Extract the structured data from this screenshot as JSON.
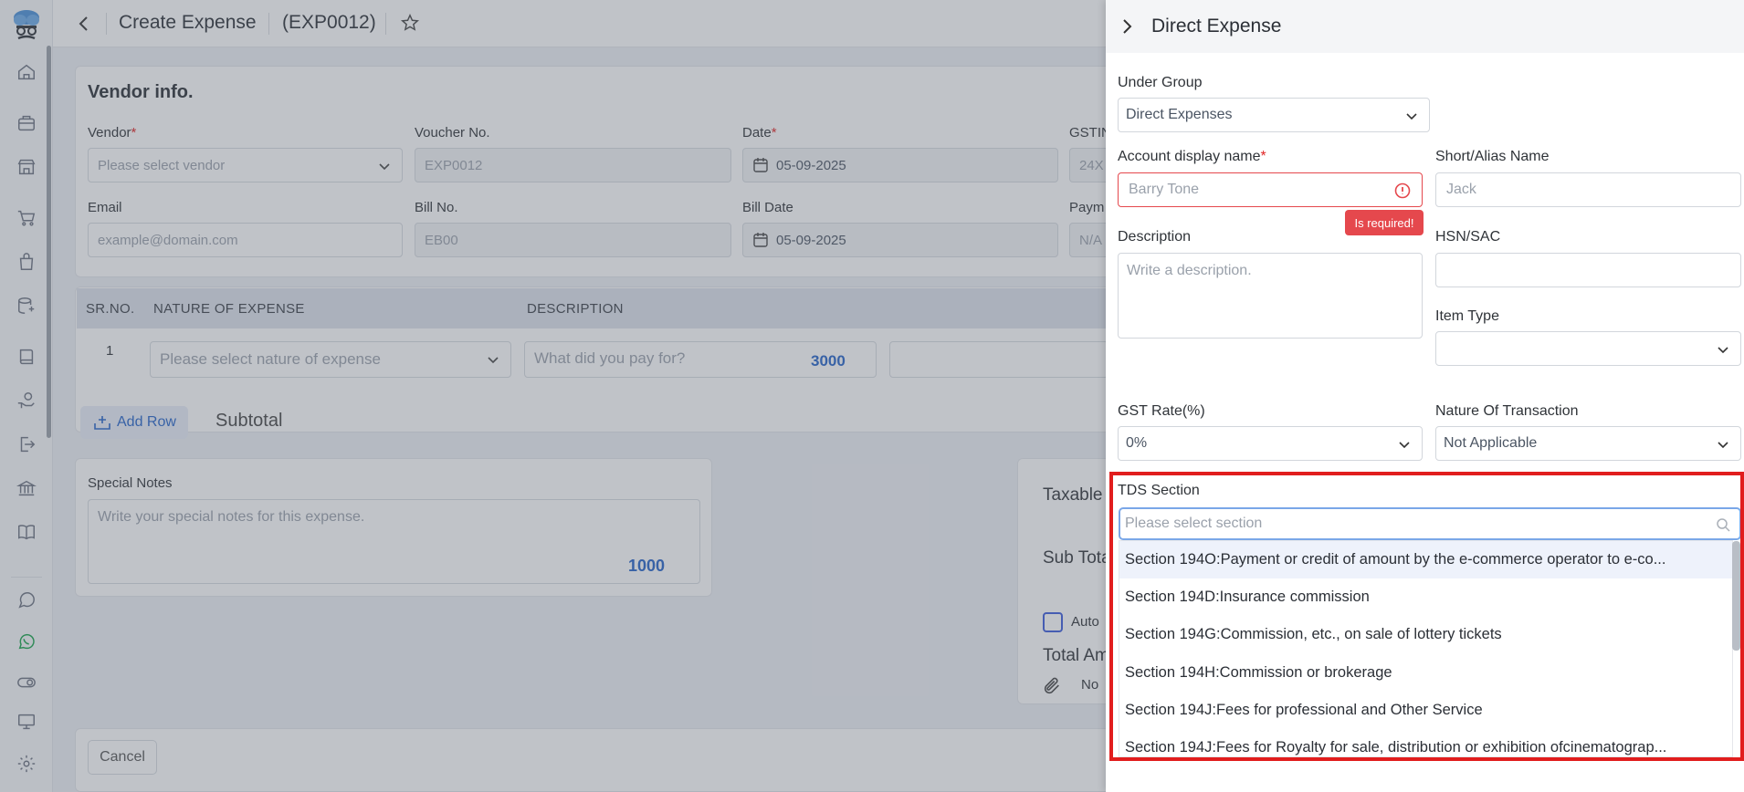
{
  "page": {
    "title": "Create Expense",
    "code": "(EXP0012)"
  },
  "vendor_info": {
    "heading": "Vendor info.",
    "vendor_label": "Vendor",
    "vendor_placeholder": "Please select vendor",
    "voucher_label": "Voucher No.",
    "voucher_value": "EXP0012",
    "date_label": "Date",
    "date_value": "05-09-2025",
    "gstin_label": "GSTIN",
    "gstin_partial": "24X",
    "email_label": "Email",
    "email_placeholder": "example@domain.com",
    "bill_no_label": "Bill No.",
    "bill_no_placeholder": "EB00",
    "bill_date_label": "Bill Date",
    "bill_date_value": "05-09-2025",
    "payment_label": "Paym",
    "payment_partial": "N/A"
  },
  "table": {
    "headers": [
      "SR.NO.",
      "NATURE OF EXPENSE",
      "DESCRIPTION"
    ],
    "row_no": "1",
    "nature_placeholder": "Please select nature of expense",
    "desc_placeholder": "What did you pay for?",
    "desc_count": "3000",
    "add_row": "Add Row",
    "subtotal": "Subtotal"
  },
  "notes": {
    "label": "Special Notes",
    "placeholder": "Write your special notes for this expense.",
    "count": "1000"
  },
  "totals": {
    "taxable": "Taxable",
    "subtotal": "Sub Tota",
    "auto": "Auto",
    "total": "Total Am",
    "attach": "No"
  },
  "footer": {
    "cancel": "Cancel"
  },
  "drawer": {
    "title": "Direct Expense",
    "under_group_label": "Under Group",
    "under_group_value": "Direct Expenses",
    "account_label": "Account display name",
    "account_placeholder": "Barry Tone",
    "error_tip": "Is required!",
    "alias_label": "Short/Alias Name",
    "alias_placeholder": "Jack",
    "description_label": "Description",
    "description_placeholder": "Write a description.",
    "hsn_label": "HSN/SAC",
    "item_type_label": "Item Type",
    "gst_label": "GST Rate(%)",
    "gst_value": "0%",
    "nature_label": "Nature Of Transaction",
    "nature_value": "Not Applicable",
    "tds_label": "TDS Section",
    "tds_placeholder": "Please select section",
    "tds_options": [
      "Section 194O:Payment or credit of amount by the e-commerce operator to e-co...",
      "Section 194D:Insurance commission",
      "Section 194G:Commission, etc., on sale of lottery tickets",
      "Section 194H:Commission or brokerage",
      "Section 194J:Fees for professional and Other Service",
      "Section 194J:Fees for Royalty for sale, distribution or exhibition ofcinematograp..."
    ]
  },
  "colors": {
    "accent": "#2563c9",
    "error": "#e5484d",
    "highlight_frame": "#e11d1d"
  }
}
